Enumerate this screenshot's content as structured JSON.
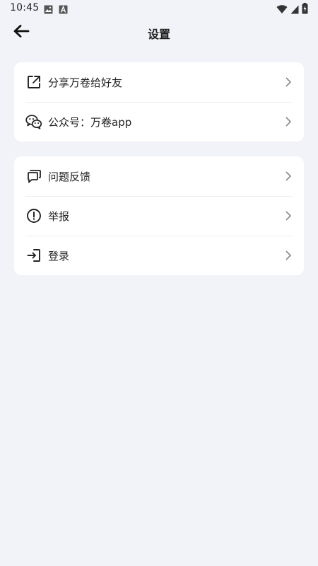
{
  "status_bar": {
    "time": "10:45",
    "left_icons": [
      "image-icon",
      "font-icon"
    ],
    "right_icons": [
      "wifi-icon",
      "signal-icon",
      "battery-charging-icon"
    ]
  },
  "app_bar": {
    "back_icon": "arrow-left-icon",
    "title": "设置"
  },
  "cards": [
    {
      "items": [
        {
          "icon": "share-external-icon",
          "label": "分享万卷给好友"
        },
        {
          "icon": "wechat-icon",
          "label": "公众号：万卷app"
        }
      ]
    },
    {
      "items": [
        {
          "icon": "feedback-chat-icon",
          "label": "问题反馈"
        },
        {
          "icon": "alert-circle-icon",
          "label": "举报"
        },
        {
          "icon": "login-icon",
          "label": "登录"
        }
      ]
    }
  ],
  "colors": {
    "background": "#f2f3f8",
    "card": "#ffffff",
    "text": "#222222",
    "chevron": "#8e8e93"
  }
}
